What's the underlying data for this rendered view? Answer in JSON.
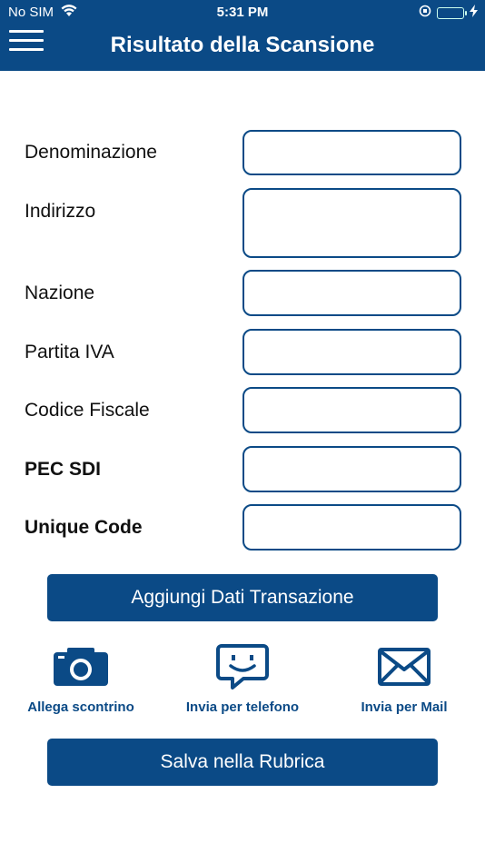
{
  "status": {
    "carrier": "No SIM",
    "time": "5:31 PM"
  },
  "header": {
    "title": "Risultato della Scansione"
  },
  "form": {
    "denominazione": {
      "label": "Denominazione",
      "value": ""
    },
    "indirizzo": {
      "label": "Indirizzo",
      "value": ""
    },
    "nazione": {
      "label": "Nazione",
      "value": ""
    },
    "partita_iva": {
      "label": "Partita IVA",
      "value": ""
    },
    "codice_fiscale": {
      "label": "Codice Fiscale",
      "value": ""
    },
    "pec_sdi": {
      "label": "PEC SDI",
      "value": ""
    },
    "unique_code": {
      "label": "Unique Code",
      "value": ""
    }
  },
  "buttons": {
    "add_transaction": "Aggiungi Dati Transazione",
    "save_contacts": "Salva nella Rubrica"
  },
  "actions": {
    "attach": {
      "label": "Allega scontrino",
      "icon": "camera-icon"
    },
    "phone": {
      "label": "Invia per telefono",
      "icon": "chat-smile-icon"
    },
    "mail": {
      "label": "Invia per Mail",
      "icon": "mail-icon"
    }
  },
  "colors": {
    "primary": "#0b4a86",
    "battery": "#4cd964"
  }
}
